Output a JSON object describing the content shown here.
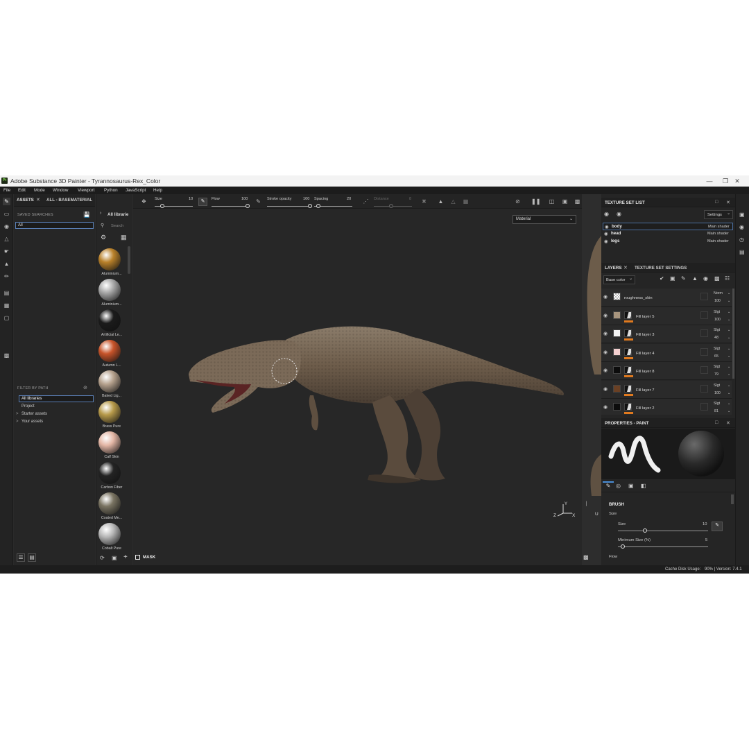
{
  "window": {
    "title": "Adobe Substance 3D Painter - Tyrannosaurus-Rex_Color",
    "app_badge": "Pt",
    "controls": [
      "—",
      "❐",
      "✕"
    ]
  },
  "menu": [
    "File",
    "Edit",
    "Mode",
    "Window",
    "Viewport",
    "Python",
    "JavaScript",
    "Help"
  ],
  "left_toolbar": {
    "icons": [
      "paint-brush-icon",
      "eraser-icon",
      "projection-icon",
      "polygon-fill-icon",
      "smudge-icon",
      "clone-stamp-icon",
      "color-picker-icon",
      "bake-icon",
      "geometry-mask-icon",
      "uv-icon",
      "export-icon"
    ]
  },
  "assets": {
    "tab_assets": "ASSETS",
    "tab_all": "ALL - BASEMATERIAL",
    "saved_searches_label": "SAVED SEARCHES",
    "saved_search_value": "All",
    "filter_by_path_label": "FILTER BY PATH",
    "tree": [
      {
        "label": "All libraries",
        "selected": true,
        "indent": 0,
        "arrow": ""
      },
      {
        "label": "Project",
        "selected": false,
        "indent": 1,
        "arrow": ""
      },
      {
        "label": "Starter assets",
        "selected": false,
        "indent": 1,
        "arrow": ">"
      },
      {
        "label": "Your assets",
        "selected": false,
        "indent": 1,
        "arrow": ">"
      }
    ]
  },
  "shelf": {
    "header": "All librarie",
    "search_placeholder": "Search",
    "materials": [
      {
        "name": "Aluminium...",
        "color": "#b9812a"
      },
      {
        "name": "Aluminium...",
        "color": "#a9a9a9"
      },
      {
        "name": "Artificial Le...",
        "color": "#1b1b1b"
      },
      {
        "name": "Autumn L...",
        "color": "#c8542a"
      },
      {
        "name": "Baked Lig...",
        "color": "#b6a28e"
      },
      {
        "name": "Brass Pure",
        "color": "#b79a4a"
      },
      {
        "name": "Calf Skin",
        "color": "#e4b7a6"
      },
      {
        "name": "Carbon Fiber",
        "color": "#232323"
      },
      {
        "name": "Coated Me...",
        "color": "#7a7462"
      },
      {
        "name": "Cobalt Pure",
        "color": "#b8b8b8"
      }
    ]
  },
  "viewport": {
    "size_label": "Size",
    "size_value": "10",
    "size_fraction": 0.2,
    "flow_label": "Flow",
    "flow_value": "100",
    "flow_fraction": 1.0,
    "stroke_opacity_label": "Stroke opacity",
    "stroke_opacity_value": "100",
    "stroke_opacity_fraction": 1.0,
    "spacing_label": "Spacing",
    "spacing_value": "20",
    "spacing_fraction": 0.1,
    "distance_label": "Distance",
    "distance_value": "8",
    "distance_fraction": 0.45,
    "material_mode": "Material",
    "mask_label": "MASK",
    "gizmo_labels": {
      "x": "X",
      "y": "Y",
      "z": "Z",
      "u": "U"
    }
  },
  "texture_set_list": {
    "title": "TEXTURE SET LIST",
    "settings_label": "Settings",
    "sets": [
      {
        "name": "body",
        "shader": "Main shader",
        "selected": true
      },
      {
        "name": "head",
        "shader": "Main shader",
        "selected": false
      },
      {
        "name": "legs",
        "shader": "Main shader",
        "selected": false
      }
    ]
  },
  "layers": {
    "tab_layers": "LAYERS",
    "tab_settings": "TEXTURE SET SETTINGS",
    "channel": "Base color",
    "items": [
      {
        "name": "roughness_skin",
        "blend": "Norm",
        "opacity": "100",
        "color": "#cfcfcf",
        "checker": true,
        "mask": false
      },
      {
        "name": "Fill layer 5",
        "blend": "Slgt",
        "opacity": "100",
        "color": "#a8957e",
        "checker": false,
        "mask": true
      },
      {
        "name": "Fill layer 3",
        "blend": "Slgt",
        "opacity": "48",
        "color": "#f2f2f2",
        "checker": false,
        "mask": true
      },
      {
        "name": "Fill layer 4",
        "blend": "Slgt",
        "opacity": "65",
        "color": "#f3cfcf",
        "checker": false,
        "mask": true
      },
      {
        "name": "Fill layer 8",
        "blend": "Slgt",
        "opacity": "79",
        "color": "#0c0c0c",
        "checker": false,
        "mask": true
      },
      {
        "name": "Fill layer 7",
        "blend": "Slgt",
        "opacity": "100",
        "color": "#6a4024",
        "checker": false,
        "mask": true
      },
      {
        "name": "Fill layer 2",
        "blend": "Slgt",
        "opacity": "81",
        "color": "#0c0c0c",
        "checker": false,
        "mask": true
      }
    ]
  },
  "properties": {
    "title": "PROPERTIES - PAINT",
    "brush_label": "BRUSH",
    "size_group_label": "Size",
    "size_label": "Size",
    "size_value": "10",
    "size_fraction": 0.3,
    "min_size_label": "Minimum Size (%)",
    "min_size_value": "5",
    "min_size_fraction": 0.05,
    "flow_label": "Flow"
  },
  "status": {
    "cache_label": "Cache Disk Usage:",
    "cache_value": "90% | Version: 7.4.1"
  }
}
